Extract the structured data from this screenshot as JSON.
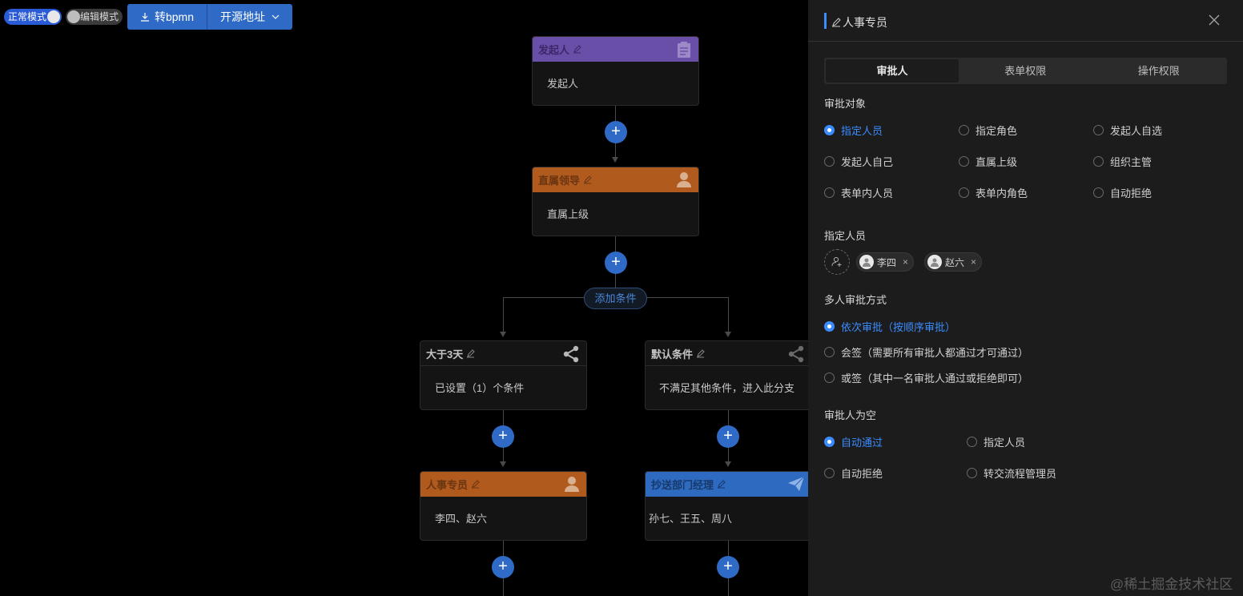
{
  "toolbar": {
    "normal_mode_label": "正常模式",
    "edit_mode_label": "编辑模式",
    "to_bpmn_label": "转bpmn",
    "open_source_label": "开源地址"
  },
  "flow": {
    "nodes": [
      {
        "title": "发起人",
        "content": "发起人"
      },
      {
        "title": "直属领导",
        "content": "直属上级"
      },
      {
        "title": "大于3天",
        "content": "已设置（1）个条件"
      },
      {
        "title": "默认条件",
        "content": "不满足其他条件，进入此分支"
      },
      {
        "title": "人事专员",
        "content": "李四、赵六"
      },
      {
        "title": "抄送部门经理",
        "content": "孙七、王五、周八"
      }
    ],
    "add_condition_label": "添加条件",
    "add_symbol": "+"
  },
  "drawer": {
    "title": "人事专员",
    "tabs": [
      {
        "label": "审批人",
        "active": true
      },
      {
        "label": "表单权限",
        "active": false
      },
      {
        "label": "操作权限",
        "active": false
      }
    ],
    "approval_target": {
      "title": "审批对象",
      "options": [
        "指定人员",
        "指定角色",
        "发起人自选",
        "发起人自己",
        "直属上级",
        "组织主管",
        "表单内人员",
        "表单内角色",
        "自动拒绝"
      ],
      "selected": "指定人员"
    },
    "assigned": {
      "title": "指定人员",
      "users": [
        "李四",
        "赵六"
      ],
      "remove_symbol": "×"
    },
    "multi_mode": {
      "title": "多人审批方式",
      "options": [
        "依次审批（按顺序审批）",
        "会签（需要所有审批人都通过才可通过）",
        "或签（其中一名审批人通过或拒绝即可）"
      ],
      "selected": "依次审批（按顺序审批）"
    },
    "empty_approver": {
      "title": "审批人为空",
      "options": [
        "自动通过",
        "指定人员",
        "自动拒绝",
        "转交流程管理员"
      ],
      "selected": "自动通过"
    }
  },
  "watermark": "@稀土掘金技术社区",
  "colors": {
    "accent": "#3b8cff",
    "button_blue": "#2f6bc6",
    "header_purple": "#6a4fa8",
    "header_orange": "#b05a1e",
    "header_blue": "#2e6bc0"
  },
  "icons": [
    "download-icon",
    "chevron-down-icon",
    "pen-icon",
    "clipboard-icon",
    "user-icon",
    "share-icon",
    "send-icon",
    "close-icon",
    "add-user-icon"
  ]
}
